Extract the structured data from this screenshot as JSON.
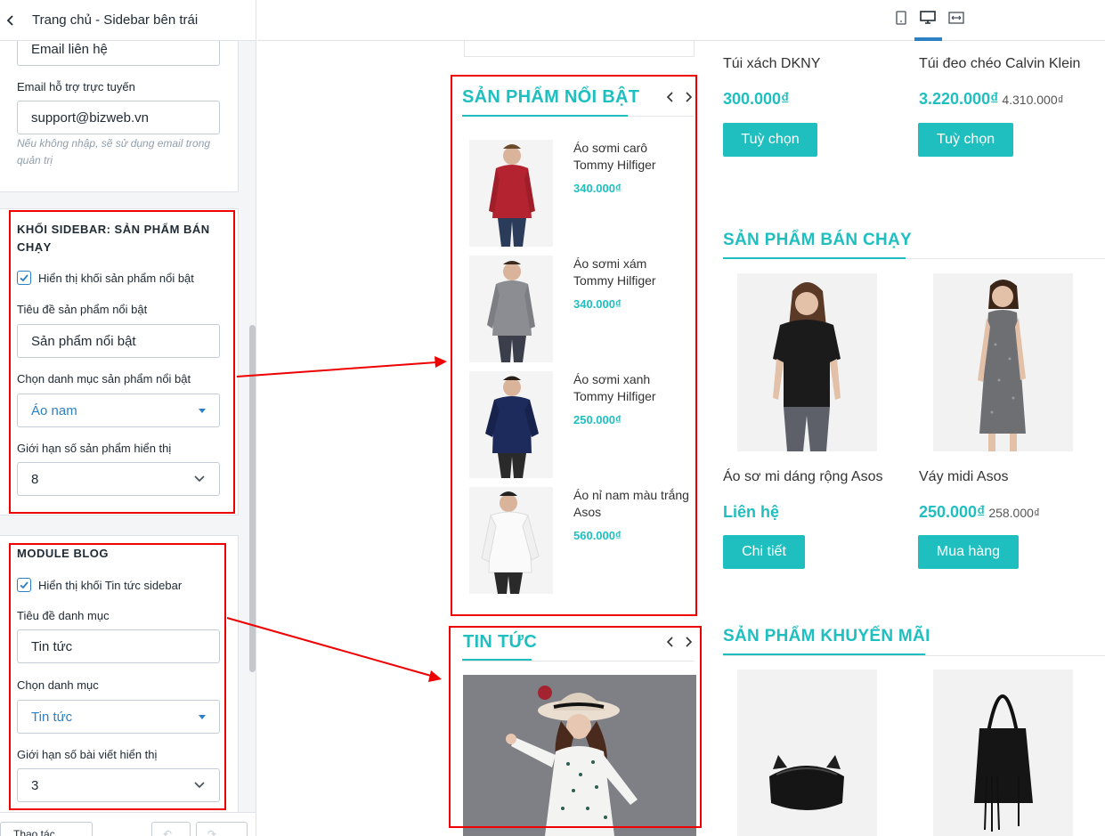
{
  "panel": {
    "title": "Trang chủ - Sidebar bên trái",
    "contact_email_label_value": "Email liên hệ",
    "support_email_label": "Email hỗ trợ trực tuyến",
    "support_email_value": "support@bizweb.vn",
    "support_email_hint": "Nếu không nhập, sẽ sử dụng email trong quản trị",
    "bestseller_block": {
      "title": "KHỐI SIDEBAR: SẢN PHẨM BÁN CHẠY",
      "show_checkbox_label": "Hiển thị khối sản phẩm nổi bật",
      "show_checked": true,
      "title_label": "Tiêu đề sản phẩm nổi bật",
      "title_value": "Sản phẩm nổi bật",
      "category_label": "Chọn danh mục sản phẩm nổi bật",
      "category_value": "Áo nam",
      "limit_label": "Giới hạn số sản phẩm hiển thị",
      "limit_value": "8"
    },
    "blog_block": {
      "title": "MODULE BLOG",
      "show_checkbox_label": "Hiển thị khối Tin tức sidebar",
      "show_checked": true,
      "title_label": "Tiêu đề danh mục",
      "title_value": "Tin tức",
      "category_label": "Chọn danh mục",
      "category_value": "Tin tức",
      "limit_label": "Giới hạn số bài viết hiển thị",
      "limit_value": "3"
    },
    "footer_left": "Thao tác"
  },
  "topbar": {
    "devices": [
      "mobile-icon",
      "desktop-icon",
      "fullwidth-icon"
    ],
    "active_device": "desktop-icon",
    "accent_color": "#2c80c4"
  },
  "preview": {
    "accent_color": "#1fbfc0",
    "featured": {
      "title": "SẢN PHẨM NỔI BẬT",
      "items": [
        {
          "name": "Áo sơmi carô Tommy Hilfiger",
          "price": "340.000₫"
        },
        {
          "name": "Áo sơmi xám Tommy Hilfiger",
          "price": "340.000₫"
        },
        {
          "name": "Áo sơmi xanh Tommy Hilfiger",
          "price": "250.000₫"
        },
        {
          "name": "Áo nỉ nam màu trắng Asos",
          "price": "560.000₫"
        }
      ]
    },
    "news": {
      "title": "TIN TỨC"
    },
    "top_products": [
      {
        "name": "Túi xách DKNY",
        "price": "300.000₫",
        "old_price": "",
        "button": "Tuỳ chọn"
      },
      {
        "name": "Túi đeo chéo Calvin Klein",
        "price": "3.220.000₫",
        "old_price": "4.310.000₫",
        "button": "Tuỳ chọn"
      }
    ],
    "bestsellers": {
      "title": "SẢN PHẨM BÁN CHẠY",
      "items": [
        {
          "name": "Áo sơ mi dáng rộng Asos",
          "price": "Liên hệ",
          "old_price": "",
          "button": "Chi tiết"
        },
        {
          "name": "Váy midi Asos",
          "price": "250.000₫",
          "old_price": "258.000₫",
          "button": "Mua hàng"
        }
      ]
    },
    "promo": {
      "title": "SẢN PHẨM KHUYẾN MÃI"
    }
  }
}
